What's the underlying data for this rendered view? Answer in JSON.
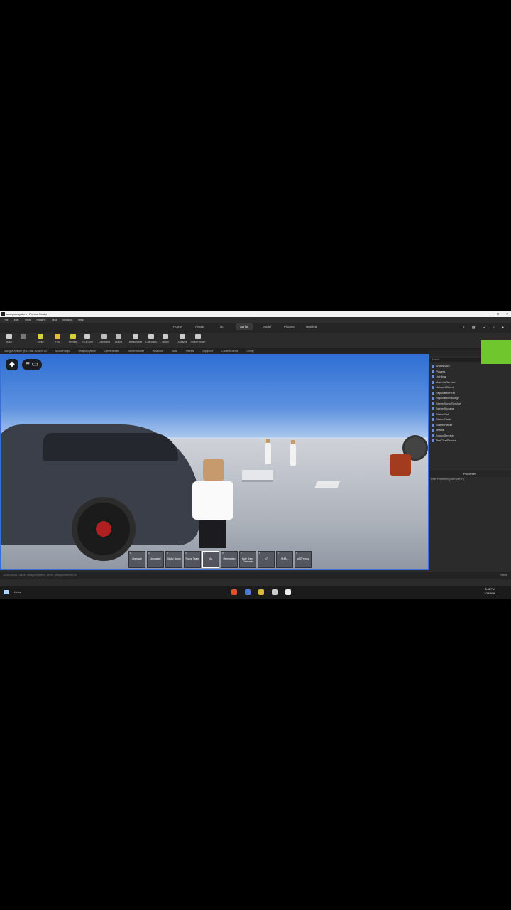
{
  "window": {
    "title": "one-gun-system - Roblox Studio",
    "controls": [
      "–",
      "□",
      "×"
    ]
  },
  "menu": [
    "File",
    "Edit",
    "View",
    "Plugins",
    "Test",
    "Window",
    "Help"
  ],
  "tabs": [
    {
      "label": "Home",
      "active": false
    },
    {
      "label": "Avatar",
      "active": false
    },
    {
      "label": "UI",
      "active": false
    },
    {
      "label": "Script",
      "active": true
    },
    {
      "label": "Model",
      "active": false
    },
    {
      "label": "Plugins",
      "active": false
    },
    {
      "label": "Untitled",
      "active": false
    }
  ],
  "ribbon": [
    {
      "label": "Back",
      "color": "#d0d0d0"
    },
    {
      "label": "",
      "color": "#777777"
    },
    {
      "label": "Script",
      "color": "#d8d23a"
    },
    {
      "label": "Find",
      "color": "#e0c23a"
    },
    {
      "label": "Replace",
      "color": "#d6cf35"
    },
    {
      "label": "Go to Line",
      "color": "#cccccc"
    },
    {
      "label": "Command",
      "color": "#bbbbbb"
    },
    {
      "label": "Output",
      "color": "#bbbbbb"
    },
    {
      "label": "Breakpoints",
      "color": "#cccccc"
    },
    {
      "label": "Call Stack",
      "color": "#cccccc"
    },
    {
      "label": "Watch",
      "color": "#cccccc"
    },
    {
      "label": "Analysis",
      "color": "#cccccc"
    },
    {
      "label": "Script Profiler",
      "color": "#cccccc"
    }
  ],
  "doc_tabs": [
    "one-gun-system @ 13 Mar 2026 09:02",
    "ModuleScript",
    "WeaponSystem",
    "ClientHandler",
    "ServerHandler",
    "Weapons",
    "Stats",
    "Presets",
    "Equipped",
    "CameraEffects",
    "Config"
  ],
  "viewport": {
    "hotbar": [
      {
        "num": "1",
        "label": "Grenade",
        "selected": false
      },
      {
        "num": "2",
        "label": "Uncoated",
        "selected": false
      },
      {
        "num": "3",
        "label": "Sticky Bomb",
        "selected": false
      },
      {
        "num": "4",
        "label": "Police Taser",
        "selected": false
      },
      {
        "num": "5",
        "label": "Ak",
        "selected": true
      },
      {
        "num": "6",
        "label": "Remington",
        "selected": false
      },
      {
        "num": "7",
        "label": "Holy Hand Grenade",
        "selected": false
      },
      {
        "num": "8",
        "label": "p7",
        "selected": false
      },
      {
        "num": "9",
        "label": "M4A1",
        "selected": false
      },
      {
        "num": "0",
        "label": "g17Frenzy",
        "selected": false
      }
    ]
  },
  "output_line": "13:55:44.431  Loaded WeaponSystem  -  Client - WeaponHandler:29",
  "output_right": "Filters",
  "explorer": {
    "title": "Explorer",
    "search_placeholder": "Search",
    "items": [
      "Workspace",
      "Players",
      "Lighting",
      "MaterialService",
      "NetworkClient",
      "ReplicatedFirst",
      "ReplicatedStorage",
      "ServerScriptService",
      "ServerStorage",
      "StarterGui",
      "StarterPack",
      "StarterPlayer",
      "Teams",
      "SoundService",
      "TextChatService"
    ]
  },
  "properties": {
    "title": "Properties",
    "filter": "Filter Properties (Ctrl+Shift+P)"
  },
  "taskbar": {
    "search": "Links",
    "time": "5:43 PM",
    "date": "3/18/2026",
    "app_colors": [
      "#e0532b",
      "#4e7bd8",
      "#d8b73a",
      "#cccccc",
      "#eeeeee"
    ]
  }
}
